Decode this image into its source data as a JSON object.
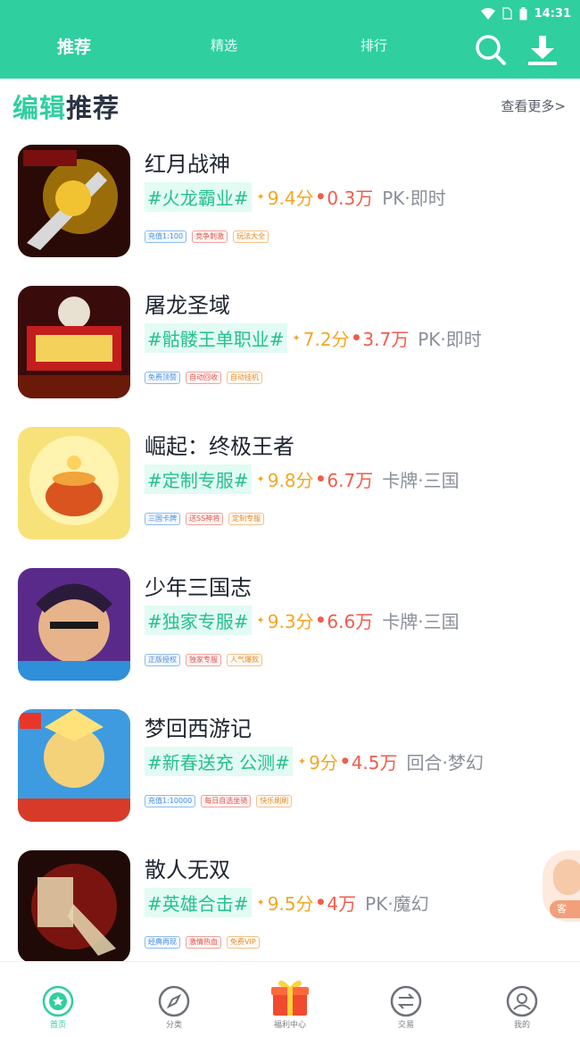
{
  "status_bar": {
    "time": "14:31"
  },
  "header": {
    "tabs": [
      {
        "label": "推荐",
        "active": true
      },
      {
        "label": "精选",
        "active": false
      },
      {
        "label": "排行",
        "active": false
      }
    ],
    "icons": [
      "search-icon",
      "download-icon"
    ]
  },
  "section": {
    "title_part1": "编辑",
    "title_part2": "推荐",
    "see_more": "查看更多>"
  },
  "games": [
    {
      "title": "红月战神",
      "hashtag": "#火龙霸业#",
      "score": "9.4分",
      "fans": "0.3万",
      "genre": "PK·即时",
      "tags": [
        {
          "text": "充值1:100",
          "style": "blue"
        },
        {
          "text": "竞争刺激",
          "style": "red"
        },
        {
          "text": "玩法大全",
          "style": "orange"
        }
      ]
    },
    {
      "title": "屠龙圣域",
      "hashtag": "#骷髅王单职业#",
      "score": "7.2分",
      "fans": "3.7万",
      "genre": "PK·即时",
      "tags": [
        {
          "text": "免费顶赞",
          "style": "blue"
        },
        {
          "text": "自动回收",
          "style": "red"
        },
        {
          "text": "自动挂机",
          "style": "orange"
        }
      ]
    },
    {
      "title": "崛起：终极王者",
      "hashtag": "#定制专服#",
      "score": "9.8分",
      "fans": "6.7万",
      "genre": "卡牌·三国",
      "tags": [
        {
          "text": "三国卡牌",
          "style": "blue"
        },
        {
          "text": "送SS神将",
          "style": "red"
        },
        {
          "text": "定制专服",
          "style": "orange"
        }
      ]
    },
    {
      "title": "少年三国志",
      "hashtag": "#独家专服#",
      "score": "9.3分",
      "fans": "6.6万",
      "genre": "卡牌·三国",
      "tags": [
        {
          "text": "正版授权",
          "style": "blue"
        },
        {
          "text": "独家专服",
          "style": "red"
        },
        {
          "text": "人气爆款",
          "style": "orange"
        }
      ]
    },
    {
      "title": "梦回西游记",
      "hashtag": "#新春送充 公测#",
      "score": "9分",
      "fans": "4.5万",
      "genre": "回合·梦幻",
      "tags": [
        {
          "text": "充值1:10000",
          "style": "blue"
        },
        {
          "text": "每日自选坐骑",
          "style": "red"
        },
        {
          "text": "快乐刷刷",
          "style": "orange"
        }
      ]
    },
    {
      "title": "散人无双",
      "hashtag": "#英雄合击#",
      "score": "9.5分",
      "fans": "4万",
      "genre": "PK·魔幻",
      "tags": [
        {
          "text": "经典再现",
          "style": "blue"
        },
        {
          "text": "激情热血",
          "style": "red"
        },
        {
          "text": "免费VIP",
          "style": "orange"
        }
      ]
    }
  ],
  "floating_helper": {
    "label": "客"
  },
  "bottom_nav": [
    {
      "label": "首页",
      "icon": "home-icon",
      "active": true
    },
    {
      "label": "分类",
      "icon": "compass-icon",
      "active": false
    },
    {
      "label": "福利中心",
      "icon": "gift-icon",
      "active": false
    },
    {
      "label": "交易",
      "icon": "trade-icon",
      "active": false
    },
    {
      "label": "我的",
      "icon": "profile-icon",
      "active": false
    }
  ],
  "colors": {
    "primary": "#2fcfa0",
    "score": "#f4a623",
    "fans": "#f25b4a",
    "title_dark": "#2b3443"
  }
}
